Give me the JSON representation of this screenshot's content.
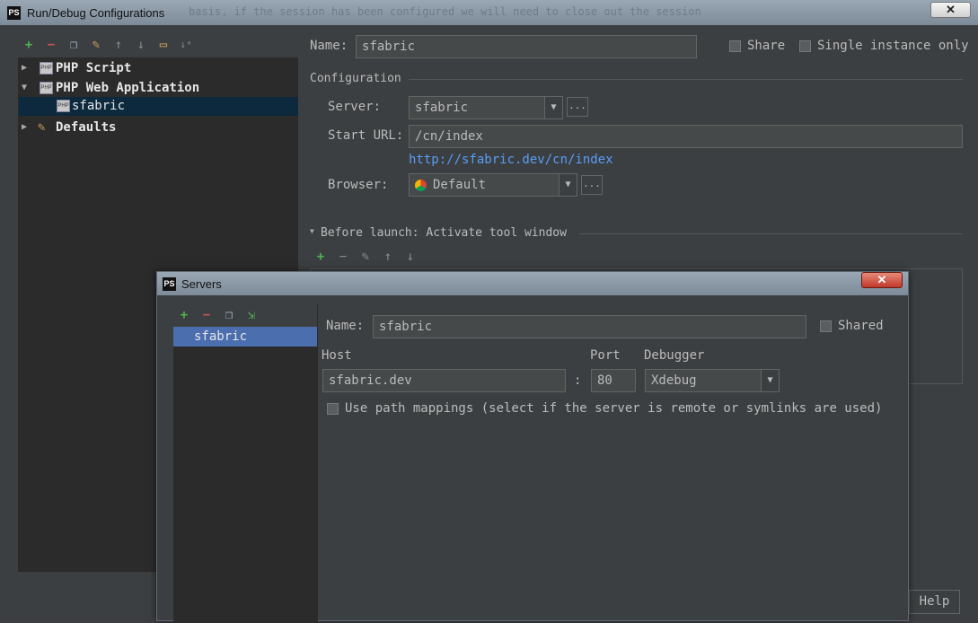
{
  "main_window": {
    "title": "Run/Debug Configurations",
    "bg_caption": "basis, if the session has been configured we will need to close out the session",
    "toolbar_icons": [
      "add-icon",
      "remove-icon",
      "copy-icon",
      "wrench-icon",
      "arrow-up-icon",
      "arrow-down-icon",
      "folder-icon",
      "sort-icon"
    ],
    "tree": [
      {
        "label": "PHP Script"
      },
      {
        "label": "PHP Web Application"
      },
      {
        "label": "sfabric"
      },
      {
        "label": "Defaults"
      }
    ],
    "name_label": "Name:",
    "name_value": "sfabric",
    "share_label": "Share",
    "single_instance_label": "Single instance only",
    "configuration_label": "Configuration",
    "server_label": "Server:",
    "server_value": "sfabric",
    "ellipsis": "...",
    "start_url_label": "Start URL:",
    "start_url_value": "/cn/index",
    "full_url": "http://sfabric.dev/cn/index",
    "browser_label": "Browser:",
    "browser_value": "Default",
    "before_launch_label": "Before launch: Activate tool window",
    "help_label": "Help"
  },
  "servers_dialog": {
    "title": "Servers",
    "list_items": [
      "sfabric"
    ],
    "name_label": "Name:",
    "name_value": "sfabric",
    "shared_label": "Shared",
    "host_label": "Host",
    "host_value": "sfabric.dev",
    "colon": ":",
    "port_label": "Port",
    "port_value": "80",
    "debugger_label": "Debugger",
    "debugger_value": "Xdebug",
    "path_mappings_label": "Use path mappings (select if the server is remote or symlinks are used)"
  },
  "colors": {
    "accent": "#4b6eaf",
    "link": "#589df6",
    "bg": "#3c3f41"
  }
}
